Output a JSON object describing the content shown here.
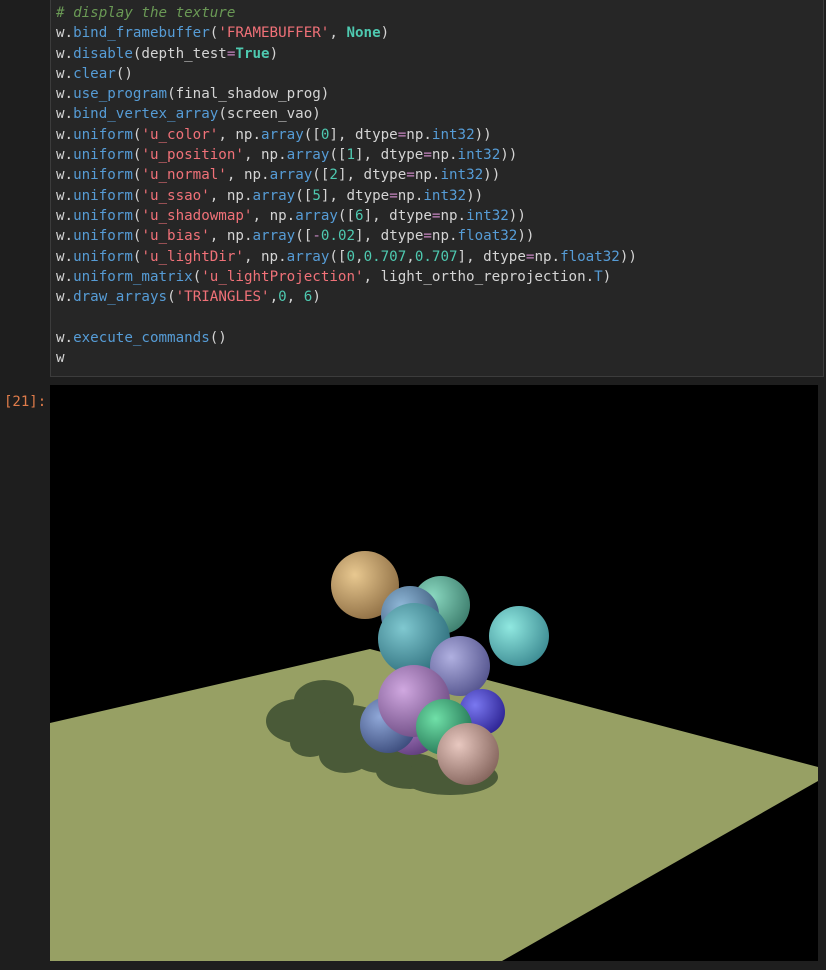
{
  "code_cell": {
    "lines": [
      [
        {
          "t": "comment",
          "v": "# display the texture"
        }
      ],
      [
        {
          "t": "obj",
          "v": "w."
        },
        {
          "t": "fn",
          "v": "bind_framebuffer"
        },
        {
          "t": "plain",
          "v": "("
        },
        {
          "t": "str",
          "v": "'FRAMEBUFFER'"
        },
        {
          "t": "plain",
          "v": ", "
        },
        {
          "t": "kwn",
          "v": "None"
        },
        {
          "t": "plain",
          "v": ")"
        }
      ],
      [
        {
          "t": "obj",
          "v": "w."
        },
        {
          "t": "fn",
          "v": "disable"
        },
        {
          "t": "plain",
          "v": "(depth_test"
        },
        {
          "t": "op",
          "v": "="
        },
        {
          "t": "kw",
          "v": "True"
        },
        {
          "t": "plain",
          "v": ")"
        }
      ],
      [
        {
          "t": "obj",
          "v": "w."
        },
        {
          "t": "fn",
          "v": "clear"
        },
        {
          "t": "plain",
          "v": "()"
        }
      ],
      [
        {
          "t": "obj",
          "v": "w."
        },
        {
          "t": "fn",
          "v": "use_program"
        },
        {
          "t": "plain",
          "v": "(final_shadow_prog)"
        }
      ],
      [
        {
          "t": "obj",
          "v": "w."
        },
        {
          "t": "fn",
          "v": "bind_vertex_array"
        },
        {
          "t": "plain",
          "v": "(screen_vao)"
        }
      ],
      [
        {
          "t": "obj",
          "v": "w."
        },
        {
          "t": "fn",
          "v": "uniform"
        },
        {
          "t": "plain",
          "v": "("
        },
        {
          "t": "str",
          "v": "'u_color'"
        },
        {
          "t": "plain",
          "v": ", np."
        },
        {
          "t": "attr",
          "v": "array"
        },
        {
          "t": "plain",
          "v": "(["
        },
        {
          "t": "num",
          "v": "0"
        },
        {
          "t": "plain",
          "v": "], dtype"
        },
        {
          "t": "op",
          "v": "="
        },
        {
          "t": "plain",
          "v": "np."
        },
        {
          "t": "attr",
          "v": "int32"
        },
        {
          "t": "plain",
          "v": "))"
        }
      ],
      [
        {
          "t": "obj",
          "v": "w."
        },
        {
          "t": "fn",
          "v": "uniform"
        },
        {
          "t": "plain",
          "v": "("
        },
        {
          "t": "str",
          "v": "'u_position'"
        },
        {
          "t": "plain",
          "v": ", np."
        },
        {
          "t": "attr",
          "v": "array"
        },
        {
          "t": "plain",
          "v": "(["
        },
        {
          "t": "num",
          "v": "1"
        },
        {
          "t": "plain",
          "v": "], dtype"
        },
        {
          "t": "op",
          "v": "="
        },
        {
          "t": "plain",
          "v": "np."
        },
        {
          "t": "attr",
          "v": "int32"
        },
        {
          "t": "plain",
          "v": "))"
        }
      ],
      [
        {
          "t": "obj",
          "v": "w."
        },
        {
          "t": "fn",
          "v": "uniform"
        },
        {
          "t": "plain",
          "v": "("
        },
        {
          "t": "str",
          "v": "'u_normal'"
        },
        {
          "t": "plain",
          "v": ", np."
        },
        {
          "t": "attr",
          "v": "array"
        },
        {
          "t": "plain",
          "v": "(["
        },
        {
          "t": "num",
          "v": "2"
        },
        {
          "t": "plain",
          "v": "], dtype"
        },
        {
          "t": "op",
          "v": "="
        },
        {
          "t": "plain",
          "v": "np."
        },
        {
          "t": "attr",
          "v": "int32"
        },
        {
          "t": "plain",
          "v": "))"
        }
      ],
      [
        {
          "t": "obj",
          "v": "w."
        },
        {
          "t": "fn",
          "v": "uniform"
        },
        {
          "t": "plain",
          "v": "("
        },
        {
          "t": "str",
          "v": "'u_ssao'"
        },
        {
          "t": "plain",
          "v": ", np."
        },
        {
          "t": "attr",
          "v": "array"
        },
        {
          "t": "plain",
          "v": "(["
        },
        {
          "t": "num",
          "v": "5"
        },
        {
          "t": "plain",
          "v": "], dtype"
        },
        {
          "t": "op",
          "v": "="
        },
        {
          "t": "plain",
          "v": "np."
        },
        {
          "t": "attr",
          "v": "int32"
        },
        {
          "t": "plain",
          "v": "))"
        }
      ],
      [
        {
          "t": "obj",
          "v": "w."
        },
        {
          "t": "fn",
          "v": "uniform"
        },
        {
          "t": "plain",
          "v": "("
        },
        {
          "t": "str",
          "v": "'u_shadowmap'"
        },
        {
          "t": "plain",
          "v": ", np."
        },
        {
          "t": "attr",
          "v": "array"
        },
        {
          "t": "plain",
          "v": "(["
        },
        {
          "t": "num",
          "v": "6"
        },
        {
          "t": "plain",
          "v": "], dtype"
        },
        {
          "t": "op",
          "v": "="
        },
        {
          "t": "plain",
          "v": "np."
        },
        {
          "t": "attr",
          "v": "int32"
        },
        {
          "t": "plain",
          "v": "))"
        }
      ],
      [
        {
          "t": "obj",
          "v": "w."
        },
        {
          "t": "fn",
          "v": "uniform"
        },
        {
          "t": "plain",
          "v": "("
        },
        {
          "t": "str",
          "v": "'u_bias'"
        },
        {
          "t": "plain",
          "v": ", np."
        },
        {
          "t": "attr",
          "v": "array"
        },
        {
          "t": "plain",
          "v": "(["
        },
        {
          "t": "op",
          "v": "-"
        },
        {
          "t": "num",
          "v": "0.02"
        },
        {
          "t": "plain",
          "v": "], dtype"
        },
        {
          "t": "op",
          "v": "="
        },
        {
          "t": "plain",
          "v": "np."
        },
        {
          "t": "attr",
          "v": "float32"
        },
        {
          "t": "plain",
          "v": "))"
        }
      ],
      [
        {
          "t": "obj",
          "v": "w."
        },
        {
          "t": "fn",
          "v": "uniform"
        },
        {
          "t": "plain",
          "v": "("
        },
        {
          "t": "str",
          "v": "'u_lightDir'"
        },
        {
          "t": "plain",
          "v": ", np."
        },
        {
          "t": "attr",
          "v": "array"
        },
        {
          "t": "plain",
          "v": "(["
        },
        {
          "t": "num",
          "v": "0"
        },
        {
          "t": "plain",
          "v": ","
        },
        {
          "t": "num",
          "v": "0.707"
        },
        {
          "t": "plain",
          "v": ","
        },
        {
          "t": "num",
          "v": "0.707"
        },
        {
          "t": "plain",
          "v": "], dtype"
        },
        {
          "t": "op",
          "v": "="
        },
        {
          "t": "plain",
          "v": "np."
        },
        {
          "t": "attr",
          "v": "float32"
        },
        {
          "t": "plain",
          "v": "))"
        }
      ],
      [
        {
          "t": "obj",
          "v": "w."
        },
        {
          "t": "fn",
          "v": "uniform_matrix"
        },
        {
          "t": "plain",
          "v": "("
        },
        {
          "t": "str",
          "v": "'u_lightProjection'"
        },
        {
          "t": "plain",
          "v": ", light_ortho_reprojection."
        },
        {
          "t": "attr",
          "v": "T"
        },
        {
          "t": "plain",
          "v": ")"
        }
      ],
      [
        {
          "t": "obj",
          "v": "w."
        },
        {
          "t": "fn",
          "v": "draw_arrays"
        },
        {
          "t": "plain",
          "v": "("
        },
        {
          "t": "str",
          "v": "'TRIANGLES'"
        },
        {
          "t": "plain",
          "v": ","
        },
        {
          "t": "num",
          "v": "0"
        },
        {
          "t": "plain",
          "v": ", "
        },
        {
          "t": "num",
          "v": "6"
        },
        {
          "t": "plain",
          "v": ")"
        }
      ],
      [
        {
          "t": "plain",
          "v": ""
        }
      ],
      [
        {
          "t": "obj",
          "v": "w."
        },
        {
          "t": "fn",
          "v": "execute_commands"
        },
        {
          "t": "plain",
          "v": "()"
        }
      ],
      [
        {
          "t": "plain",
          "v": "w"
        }
      ]
    ]
  },
  "output_cell": {
    "prompt": "[21]:"
  },
  "render": {
    "background_color": "#000000",
    "floor_color": "#97a064",
    "shadow_color": "#4a5a38",
    "spheres": [
      {
        "color": "#c8a870",
        "name": "tan-sphere"
      },
      {
        "color": "#6fb8a8",
        "name": "teal-sphere-back"
      },
      {
        "color": "#7a9ad8",
        "name": "blue-sphere-back"
      },
      {
        "color": "#70c8c8",
        "name": "cyan-sphere-right"
      },
      {
        "color": "#6a98b8",
        "name": "steel-sphere"
      },
      {
        "color": "#5aa8b0",
        "name": "teal-sphere-front"
      },
      {
        "color": "#8888c0",
        "name": "lavender-sphere"
      },
      {
        "color": "#5a50d0",
        "name": "indigo-sphere"
      },
      {
        "color": "#a070b8",
        "name": "violet-sphere"
      },
      {
        "color": "#6888b8",
        "name": "slate-sphere"
      },
      {
        "color": "#b088c0",
        "name": "orchid-sphere"
      },
      {
        "color": "#48b888",
        "name": "green-sphere"
      },
      {
        "color": "#c8a098",
        "name": "rose-sphere"
      }
    ]
  }
}
